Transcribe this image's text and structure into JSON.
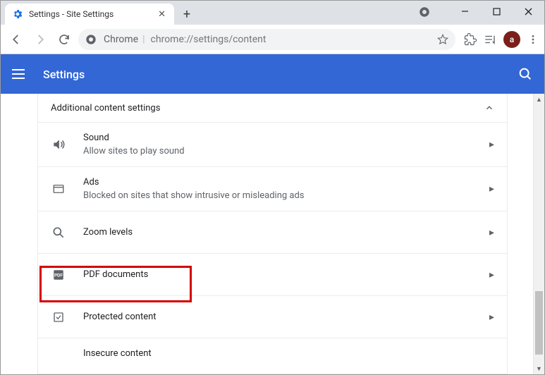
{
  "window": {
    "tab_title": "Settings - Site Settings"
  },
  "toolbar": {
    "address_prefix": "Chrome",
    "address_url": "chrome://settings/content",
    "avatar_letter": "a"
  },
  "appbar": {
    "title": "Settings"
  },
  "section": {
    "header": "Additional content settings",
    "items": [
      {
        "title": "Sound",
        "desc": "Allow sites to play sound"
      },
      {
        "title": "Ads",
        "desc": "Blocked on sites that show intrusive or misleading ads"
      },
      {
        "title": "Zoom levels",
        "desc": ""
      },
      {
        "title": "PDF documents",
        "desc": ""
      },
      {
        "title": "Protected content",
        "desc": ""
      },
      {
        "title": "Insecure content",
        "desc": ""
      }
    ]
  }
}
